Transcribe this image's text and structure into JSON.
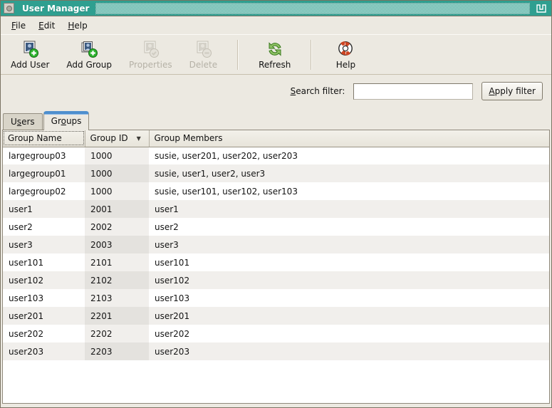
{
  "window": {
    "title": "User Manager"
  },
  "menu": {
    "file": {
      "key": "F",
      "post": "ile"
    },
    "edit": {
      "key": "E",
      "post": "dit"
    },
    "help": {
      "key": "H",
      "post": "elp"
    }
  },
  "toolbar": {
    "buttons": [
      {
        "label": "Add User",
        "enabled": true
      },
      {
        "label": "Add Group",
        "enabled": true
      },
      {
        "label": "Properties",
        "enabled": false
      },
      {
        "label": "Delete",
        "enabled": false
      },
      {
        "label": "Refresh",
        "enabled": true
      },
      {
        "label": "Help",
        "enabled": true
      }
    ]
  },
  "filter": {
    "label": {
      "key": "S",
      "post": "earch filter:"
    },
    "input": {
      "value": ""
    },
    "button": {
      "key": "A",
      "post": "pply filter"
    }
  },
  "tabs": {
    "users": {
      "pre": "U",
      "key": "s",
      "post": "ers"
    },
    "groups": {
      "pre": "Gr",
      "key": "o",
      "post": "ups"
    },
    "active": "Groups"
  },
  "table": {
    "columns": [
      {
        "label": "Group Name"
      },
      {
        "label": "Group ID",
        "sorted": true
      },
      {
        "label": "Group Members"
      }
    ],
    "sort_indicator": "▼",
    "rows": [
      {
        "name": "largegroup03",
        "id": "1000",
        "members": "susie, user201, user202, user203"
      },
      {
        "name": "largegroup01",
        "id": "1000",
        "members": "susie, user1, user2, user3"
      },
      {
        "name": "largegroup02",
        "id": "1000",
        "members": "susie, user101, user102, user103"
      },
      {
        "name": "user1",
        "id": "2001",
        "members": "user1"
      },
      {
        "name": "user2",
        "id": "2002",
        "members": "user2"
      },
      {
        "name": "user3",
        "id": "2003",
        "members": "user3"
      },
      {
        "name": "user101",
        "id": "2101",
        "members": "user101"
      },
      {
        "name": "user102",
        "id": "2102",
        "members": "user102"
      },
      {
        "name": "user103",
        "id": "2103",
        "members": "user103"
      },
      {
        "name": "user201",
        "id": "2201",
        "members": "user201"
      },
      {
        "name": "user202",
        "id": "2202",
        "members": "user202"
      },
      {
        "name": "user203",
        "id": "2203",
        "members": "user203"
      }
    ]
  },
  "colors": {
    "titlebar_teal": "#2f9f90",
    "active_tab_blue": "#4e8fce",
    "window_bg": "#ece9e1",
    "badge_green": "#2db22d",
    "refresh_green": "#73ab4d",
    "help_red": "#c8401f",
    "disabled_text": "#b5b1a6"
  }
}
